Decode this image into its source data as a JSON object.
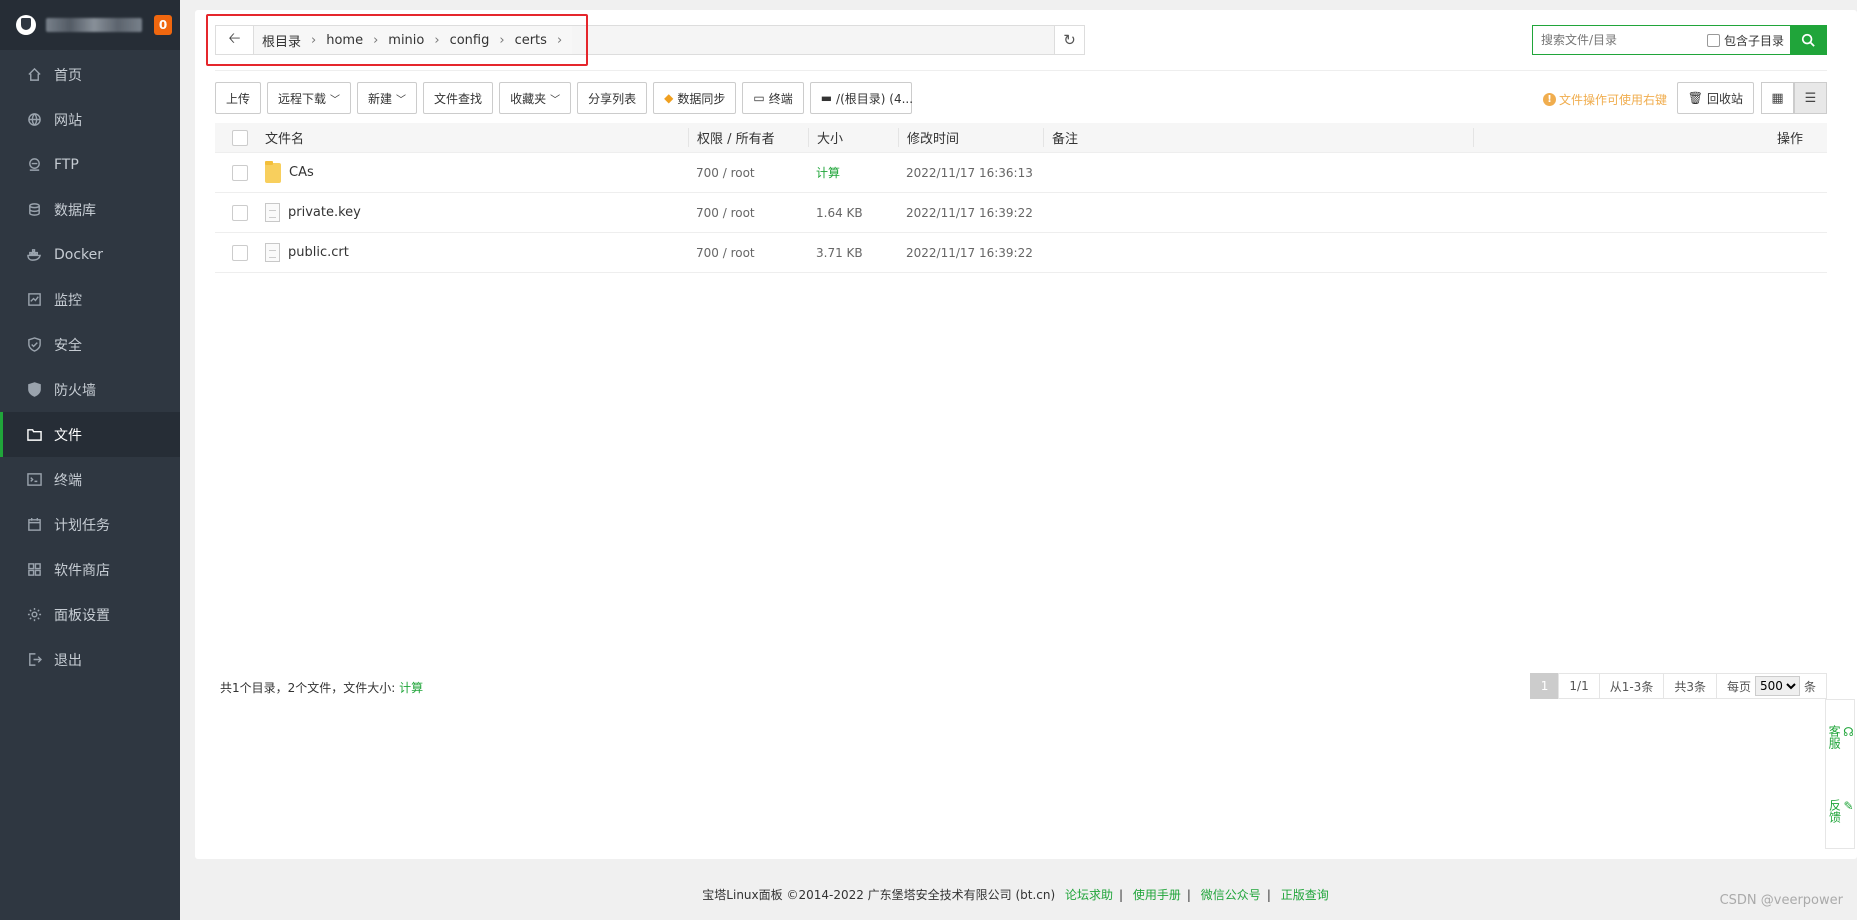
{
  "sidebar": {
    "badge": "0",
    "items": [
      {
        "label": "首页",
        "icon": "home-icon"
      },
      {
        "label": "网站",
        "icon": "globe-icon"
      },
      {
        "label": "FTP",
        "icon": "ftp-icon"
      },
      {
        "label": "数据库",
        "icon": "database-icon"
      },
      {
        "label": "Docker",
        "icon": "docker-icon"
      },
      {
        "label": "监控",
        "icon": "monitor-icon"
      },
      {
        "label": "安全",
        "icon": "shield-icon"
      },
      {
        "label": "防火墙",
        "icon": "firewall-icon"
      },
      {
        "label": "文件",
        "icon": "folder-icon"
      },
      {
        "label": "终端",
        "icon": "terminal-icon"
      },
      {
        "label": "计划任务",
        "icon": "calendar-icon"
      },
      {
        "label": "软件商店",
        "icon": "apps-icon"
      },
      {
        "label": "面板设置",
        "icon": "gear-icon"
      },
      {
        "label": "退出",
        "icon": "logout-icon"
      }
    ],
    "active_index": 8
  },
  "path": {
    "crumbs": [
      "根目录",
      "home",
      "minio",
      "config",
      "certs"
    ]
  },
  "search": {
    "placeholder": "搜索文件/目录",
    "include_sub_label": "包含子目录"
  },
  "toolbar": {
    "upload": "上传",
    "remote_download": "远程下载",
    "new": "新建",
    "find": "文件查找",
    "favorites": "收藏夹",
    "share_list": "分享列表",
    "data_sync": "数据同步",
    "terminal": "终端",
    "disk": "/(根目录) (4...",
    "tip": "文件操作可使用右键",
    "recycle": "回收站"
  },
  "table": {
    "headers": {
      "name": "文件名",
      "perm": "权限 / 所有者",
      "size": "大小",
      "mtime": "修改时间",
      "note": "备注",
      "ops": "操作"
    },
    "rows": [
      {
        "type": "folder",
        "name": "CAs",
        "perm": "700 / root",
        "size": "计算",
        "mtime": "2022/11/17 16:36:13",
        "note": ""
      },
      {
        "type": "file",
        "name": "private.key",
        "perm": "700 / root",
        "size": "1.64 KB",
        "mtime": "2022/11/17 16:39:22",
        "note": ""
      },
      {
        "type": "file",
        "name": "public.crt",
        "perm": "700 / root",
        "size": "3.71 KB",
        "mtime": "2022/11/17 16:39:22",
        "note": ""
      }
    ]
  },
  "summary": {
    "text": "共1个目录，2个文件，文件大小:",
    "calc": "计算"
  },
  "pager": {
    "current": "1",
    "pages": "1/1",
    "range": "从1-3条",
    "total": "共3条",
    "per_page_label": "每页",
    "per_page_value": "500",
    "unit": "条"
  },
  "footer": {
    "copyright": "宝塔Linux面板 ©2014-2022 广东堡塔安全技术有限公司 (bt.cn)",
    "links": [
      "论坛求助",
      "使用手册",
      "微信公众号",
      "正版查询"
    ]
  },
  "watermark": "CSDN @veerpower",
  "float": {
    "service": "客服",
    "feedback": "反馈"
  },
  "colors": {
    "accent": "#20a53a",
    "sidebar_bg": "#2f3741",
    "highlight": "#e5262c",
    "tip": "#f0ad4e"
  }
}
